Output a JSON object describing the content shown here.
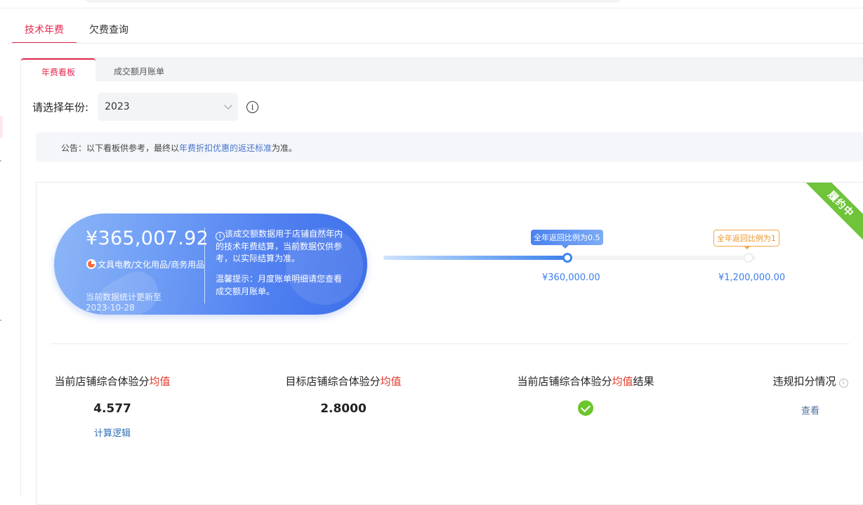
{
  "tabs": {
    "items": [
      {
        "label": "技术年费"
      },
      {
        "label": "欠费查询"
      }
    ]
  },
  "sub_tabs": {
    "items": [
      {
        "label": "年费看板"
      },
      {
        "label": "成交额月账单"
      }
    ]
  },
  "year_filter": {
    "label": "请选择年份:",
    "value": "2023",
    "info_icon": "i"
  },
  "notice": {
    "prefix": "公告：以下看板供参考，最终以",
    "link": "年费折扣优惠的返还标准",
    "suffix": "为准。"
  },
  "status_ribbon": "履约中",
  "summary": {
    "amount": "¥365,007.92",
    "category": "文具电教/文化用品/商务用品",
    "updated": "当前数据统计更新至 2023-10-28",
    "info_icon": "i",
    "description": "该成交额数据用于店铺自然年内的技术年费结算，当前数据仅供参考，以实际结算为准。",
    "tip": "温馨提示：月度账单明细请您查看成交额月账单。"
  },
  "progress": {
    "fill": 0.5,
    "milestones": [
      {
        "tag": "全年返回比例为0.5",
        "amount": "¥360,000.00"
      },
      {
        "tag": "全年返回比例为1",
        "amount": "¥1,200,000.00"
      }
    ]
  },
  "metrics": {
    "current_score": {
      "title_prefix": "当前店铺综合体验分",
      "title_red": "均值",
      "value": "4.577",
      "link": "计算逻辑"
    },
    "target_score": {
      "title_prefix": "目标店铺综合体验分",
      "title_red": "均值",
      "value": "2.8000"
    },
    "result": {
      "title_prefix": "当前店铺综合体验分",
      "title_red": "均值",
      "title_suffix": "结果"
    },
    "violation": {
      "title": "违规扣分情况",
      "info_icon": "i",
      "link": "查看"
    }
  },
  "colors": {
    "accent": "#e5294f",
    "blue": "#3d7fea",
    "green": "#6cc62b",
    "orange": "#e9962c"
  }
}
